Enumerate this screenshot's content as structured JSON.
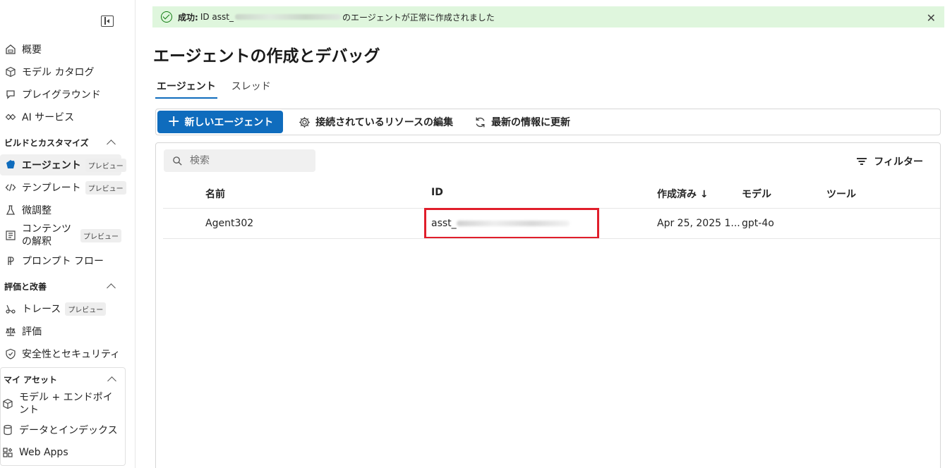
{
  "sidebar": {
    "items": [
      {
        "label": "概要",
        "icon": "home-icon"
      },
      {
        "label": "モデル カタログ",
        "icon": "cube-icon"
      },
      {
        "label": "プレイグラウンド",
        "icon": "chat-icon"
      },
      {
        "label": "AI サービス",
        "icon": "link-icon"
      }
    ],
    "section_build": "ビルドとカスタマイズ",
    "build_items": [
      {
        "label": "エージェント",
        "badge": "プレビュー"
      },
      {
        "label": "テンプレート",
        "badge": "プレビュー"
      },
      {
        "label": "微調整"
      },
      {
        "label": "コンテンツの解釈",
        "badge": "プレビュー"
      },
      {
        "label": "プロンプト フロー"
      }
    ],
    "section_eval": "評価と改善",
    "eval_items": [
      {
        "label": "トレース",
        "badge": "プレビュー"
      },
      {
        "label": "評価"
      },
      {
        "label": "安全性とセキュリティ"
      }
    ],
    "section_assets": "マイ アセット",
    "asset_items": [
      {
        "label": "モデル + エンドポイント"
      },
      {
        "label": "データとインデックス"
      },
      {
        "label": "Web Apps"
      }
    ]
  },
  "banner": {
    "status": "成功:",
    "prefix": "ID asst_",
    "suffix": "のエージェントが正常に作成されました"
  },
  "page_title": "エージェントの作成とデバッグ",
  "tabs": [
    "エージェント",
    "スレッド"
  ],
  "toolbar": {
    "new_agent": "新しいエージェント",
    "edit_resources": "接続されているリソースの編集",
    "refresh": "最新の情報に更新"
  },
  "search": {
    "placeholder": "検索"
  },
  "filter_label": "フィルター",
  "table": {
    "headers": [
      "名前",
      "ID",
      "作成済み ↓",
      "モデル",
      "ツール"
    ],
    "rows": [
      {
        "name": "Agent302",
        "id": "asst_",
        "created": "Apr 25, 2025 1...",
        "model": "gpt-4o",
        "tools": ""
      }
    ]
  },
  "colors": {
    "accent": "#0f6cbd",
    "success_bg": "#dff6dd",
    "highlight": "#e01e2b"
  }
}
